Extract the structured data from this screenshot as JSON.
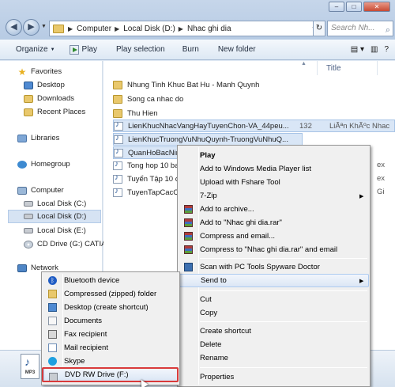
{
  "address": {
    "crumbs": [
      "Computer",
      "Local Disk (D:)",
      "Nhac ghi dia"
    ],
    "search_placeholder": "Search Nh..."
  },
  "toolbar": {
    "organize": "Organize",
    "play": "Play",
    "play_selection": "Play selection",
    "burn": "Burn",
    "new_folder": "New folder"
  },
  "nav": {
    "favorites": "Favorites",
    "desktop": "Desktop",
    "downloads": "Downloads",
    "recent_places": "Recent Places",
    "libraries": "Libraries",
    "homegroup": "Homegroup",
    "computer": "Computer",
    "drive_c": "Local Disk (C:)",
    "drive_d": "Local Disk (D:)",
    "drive_e": "Local Disk (E:)",
    "drive_g": "CD Drive (G:) CATIA",
    "network": "Network"
  },
  "columns": {
    "title": "Title"
  },
  "files": [
    {
      "name": "Nhung Tinh Khuc Bat Hu - Manh Quynh",
      "type": "folder"
    },
    {
      "name": "Song ca nhac do",
      "type": "folder"
    },
    {
      "name": "Thu Hien",
      "type": "folder"
    },
    {
      "name": "LienKhucNhacVangHayTuyenChon-VA_44peu...",
      "type": "media",
      "size": "132",
      "title": "LiÃªn KhÃºc Nhac"
    },
    {
      "name": "LienKhucTruongVuNhuQuynh-TruongVuNhuQ...",
      "type": "media"
    },
    {
      "name": "QuanHoBacNin",
      "type": "media"
    },
    {
      "name": "Tong hop 10 ba",
      "type": "media"
    },
    {
      "name": "Tuyển Tập 10 c",
      "type": "media"
    },
    {
      "name": "TuyenTapCacC",
      "type": "media"
    }
  ],
  "right_fragments": {
    "r6": "ex",
    "r7": "ex",
    "r8": "Gi"
  },
  "context_menu": {
    "play": "Play",
    "add_wmp": "Add to Windows Media Player list",
    "upload_fshare": "Upload with Fshare Tool",
    "sevenzip": "7-Zip",
    "add_archive": "Add to archive...",
    "add_rar": "Add to \"Nhac ghi dia.rar\"",
    "compress_email": "Compress and email...",
    "compress_rar_email": "Compress to \"Nhac ghi dia.rar\" and email",
    "scan": "Scan with PC Tools Spyware Doctor",
    "send_to": "Send to",
    "cut": "Cut",
    "copy": "Copy",
    "create_shortcut": "Create shortcut",
    "delete": "Delete",
    "rename": "Rename",
    "properties": "Properties"
  },
  "send_to_menu": [
    {
      "label": "Bluetooth device",
      "icon": "bluetooth-icon"
    },
    {
      "label": "Compressed (zipped) folder",
      "icon": "zip-folder-icon"
    },
    {
      "label": "Desktop (create shortcut)",
      "icon": "desktop-icon"
    },
    {
      "label": "Documents",
      "icon": "documents-icon"
    },
    {
      "label": "Fax recipient",
      "icon": "fax-icon"
    },
    {
      "label": "Mail recipient",
      "icon": "mail-icon"
    },
    {
      "label": "Skype",
      "icon": "skype-icon"
    },
    {
      "label": "DVD RW Drive (F:)",
      "icon": "dvd-drive-icon"
    }
  ],
  "details": {
    "badge": "MP3"
  }
}
